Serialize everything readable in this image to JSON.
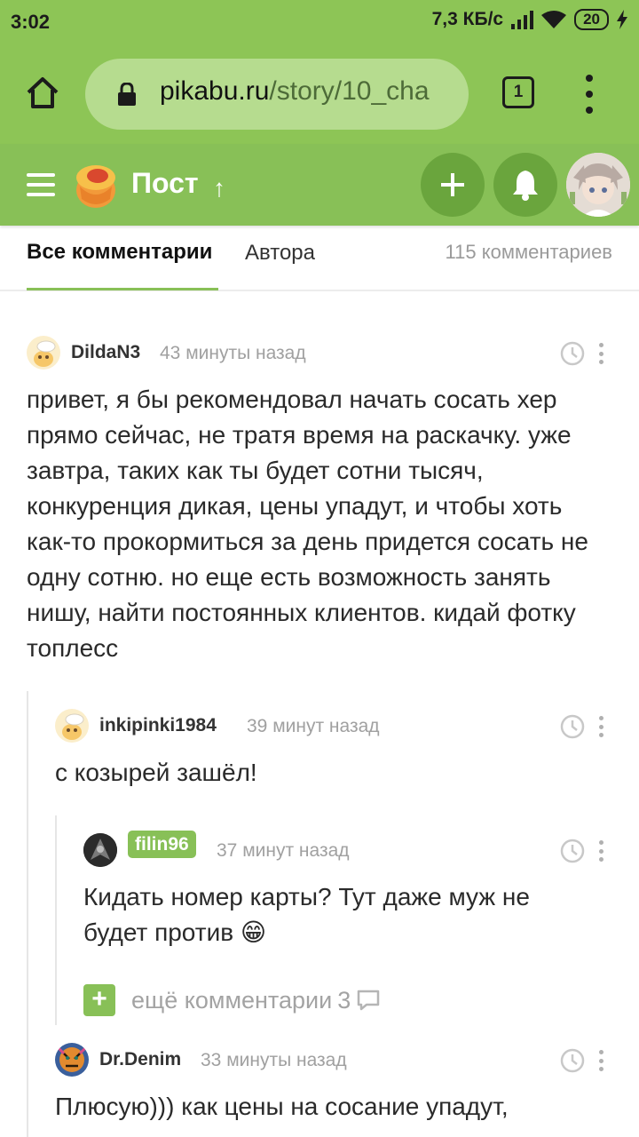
{
  "status_bar": {
    "time": "3:02",
    "network_speed": "7,3 КБ/с",
    "battery": "20"
  },
  "browser": {
    "url_domain": "pikabu.ru",
    "url_path": "/story/10_cha",
    "tab_count": "1"
  },
  "site_header": {
    "title": "Пост",
    "accent_color": "#88c057"
  },
  "comment_tabs": {
    "all_label": "Все комментарии",
    "author_label": "Автора",
    "count_label": "115 комментариев"
  },
  "comments": [
    {
      "author": "DildaN3",
      "time": "43 минуты назад",
      "text": "привет, я бы рекомендовал начать сосать хер прямо сейчас, не тратя время на раскачку. уже завтра, таких как ты будет сотни тысяч, конкуренция дикая, цены упадут, и чтобы хоть как-то прокормиться за день придется сосать не одну сотню. но еще есть возможность занять нишу, найти постоянных клиентов. кидай фотку топлесс"
    },
    {
      "author": "inkipinki1984",
      "time": "39 минут назад",
      "text": "с козырей зашёл!"
    },
    {
      "author": "filin96",
      "time": "37 минут назад",
      "text": "Кидать номер карты? Тут даже муж не будет против 😁"
    },
    {
      "author": "Dr.Denim",
      "time": "33 минуты назад",
      "text": "Плюсую))) как цены на сосание упадут,"
    }
  ],
  "more_comments": {
    "label": "ещё комментарии",
    "count": "3"
  }
}
